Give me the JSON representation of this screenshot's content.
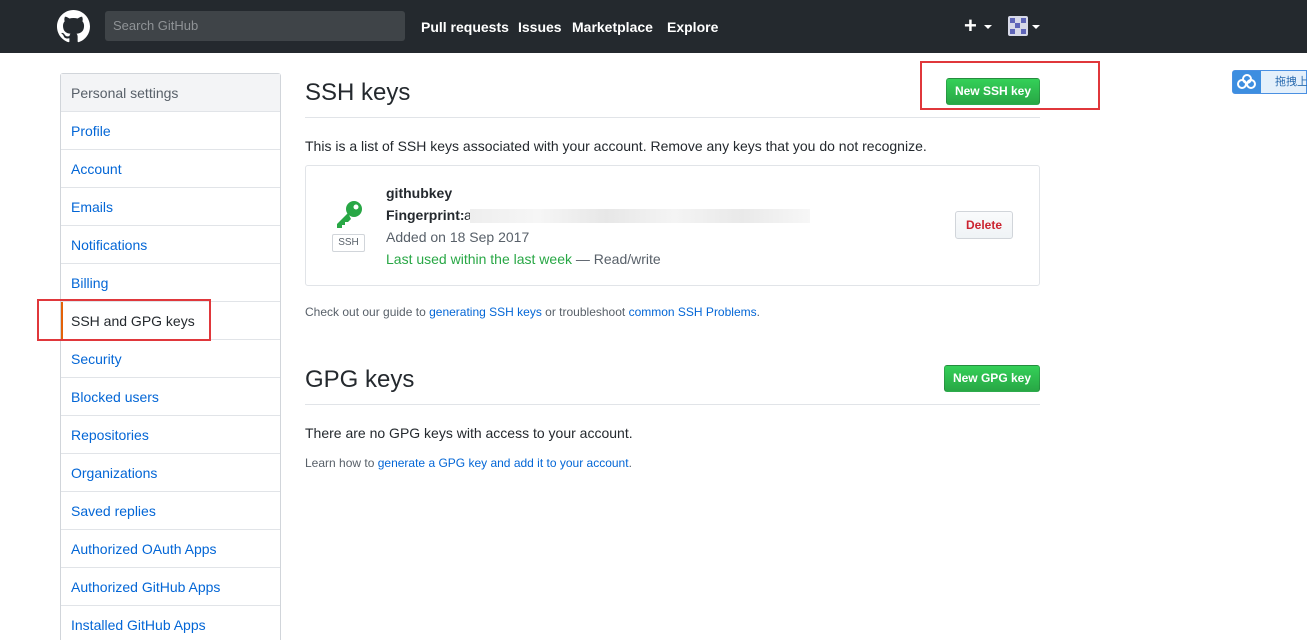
{
  "header": {
    "search_placeholder": "Search GitHub",
    "nav": [
      "Pull requests",
      "Issues",
      "Marketplace",
      "Explore"
    ],
    "plus_label": "+"
  },
  "sidebar": {
    "heading": "Personal settings",
    "items": [
      {
        "label": "Profile"
      },
      {
        "label": "Account"
      },
      {
        "label": "Emails"
      },
      {
        "label": "Notifications"
      },
      {
        "label": "Billing"
      },
      {
        "label": "SSH and GPG keys",
        "selected": true
      },
      {
        "label": "Security"
      },
      {
        "label": "Blocked users"
      },
      {
        "label": "Repositories"
      },
      {
        "label": "Organizations"
      },
      {
        "label": "Saved replies"
      },
      {
        "label": "Authorized OAuth Apps"
      },
      {
        "label": "Authorized GitHub Apps"
      },
      {
        "label": "Installed GitHub Apps"
      }
    ]
  },
  "ssh": {
    "title": "SSH keys",
    "new_button": "New SSH key",
    "description": "This is a list of SSH keys associated with your account. Remove any keys that you do not recognize.",
    "key": {
      "name": "githubkey",
      "fingerprint_label": "Fingerprint:",
      "fingerprint_visible": "a",
      "added": "Added on 18 Sep 2017",
      "last_used": "Last used within the last week",
      "access": "— Read/write",
      "type_label": "SSH",
      "delete_button": "Delete"
    },
    "guide_prefix": "Check out our guide to",
    "guide_link1": "generating SSH keys",
    "guide_middle": "or troubleshoot",
    "guide_link2": "common SSH Problems",
    "guide_suffix": "."
  },
  "gpg": {
    "title": "GPG keys",
    "new_button": "New GPG key",
    "empty_text": "There are no GPG keys with access to your account.",
    "learn_prefix": "Learn how to",
    "learn_link": "generate a GPG key and add it to your account",
    "learn_suffix": "."
  },
  "widget": {
    "label": "拖拽上"
  },
  "colors": {
    "header_bg": "#24292e",
    "link": "#0366d6",
    "green": "#28a745",
    "selected_border": "#e36209",
    "annotation_red": "#e0373b",
    "delete_red": "#cb2431"
  }
}
